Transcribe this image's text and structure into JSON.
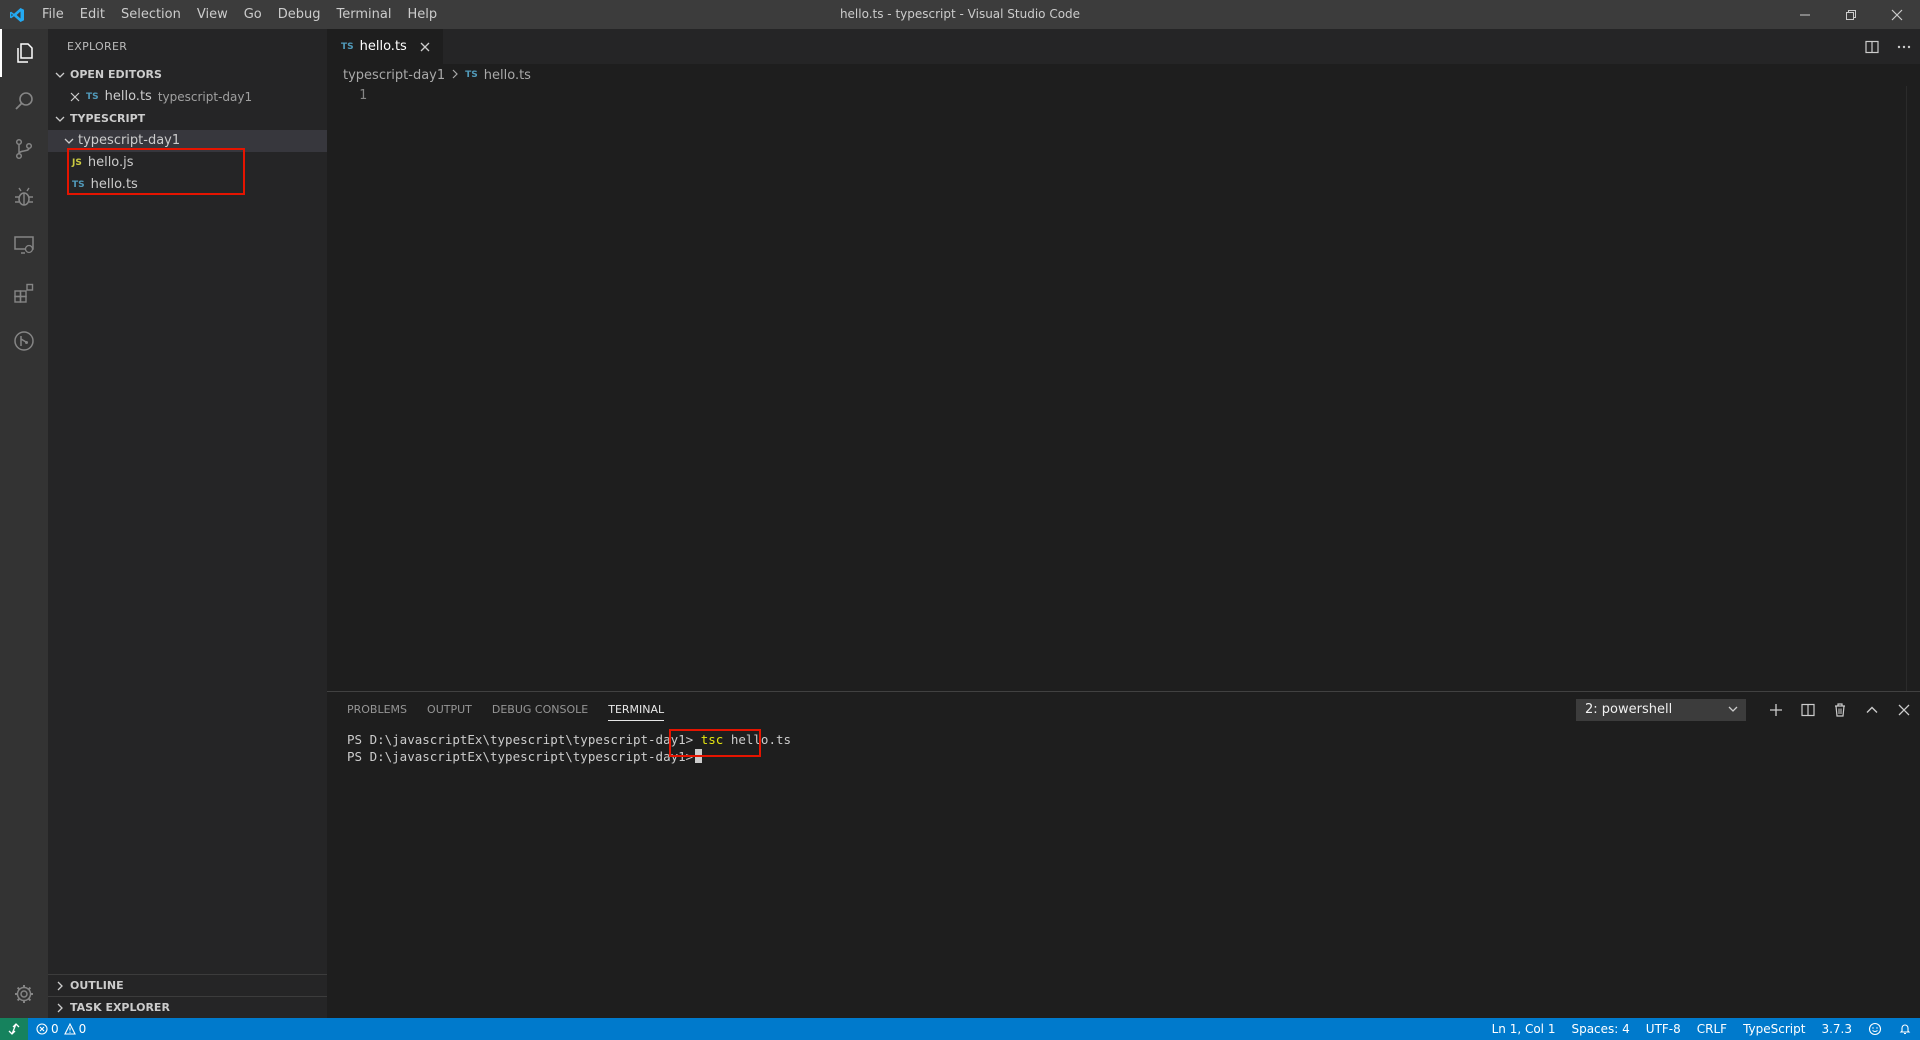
{
  "window": {
    "title": "hello.ts - typescript - Visual Studio Code"
  },
  "menu": [
    "File",
    "Edit",
    "Selection",
    "View",
    "Go",
    "Debug",
    "Terminal",
    "Help"
  ],
  "sidebar": {
    "title": "EXPLORER",
    "open_editors_header": "OPEN EDITORS",
    "open_editor": {
      "badge": "TS",
      "name": "hello.ts",
      "description": "typescript-day1"
    },
    "workspace_header": "TYPESCRIPT",
    "folder": "typescript-day1",
    "files": [
      {
        "badge": "JS",
        "name": "hello.js"
      },
      {
        "badge": "TS",
        "name": "hello.ts"
      }
    ],
    "outline_header": "OUTLINE",
    "task_explorer_header": "TASK EXPLORER"
  },
  "editor": {
    "tab": {
      "badge": "TS",
      "name": "hello.ts"
    },
    "breadcrumb": {
      "folder": "typescript-day1",
      "badge": "TS",
      "file": "hello.ts"
    },
    "line_number": "1"
  },
  "panel": {
    "tabs": [
      "PROBLEMS",
      "OUTPUT",
      "DEBUG CONSOLE",
      "TERMINAL"
    ],
    "active_tab": "TERMINAL",
    "terminal_select": "2: powershell",
    "lines": [
      {
        "prompt": "PS D:\\javascriptEx\\typescript\\typescript-day1>",
        "cmd": "tsc",
        "arg": "hello.ts"
      },
      {
        "prompt": "PS D:\\javascriptEx\\typescript\\typescript-day1>",
        "cmd": "",
        "arg": ""
      }
    ]
  },
  "statusbar": {
    "errors": "0",
    "warnings": "0",
    "position": "Ln 1, Col 1",
    "spaces": "Spaces: 4",
    "encoding": "UTF-8",
    "eol": "CRLF",
    "language": "TypeScript",
    "version": "3.7.3"
  },
  "colors": {
    "accent": "#007acc",
    "highlight": "#e51400",
    "ts_badge": "#519aba",
    "js_badge": "#cbcb41"
  },
  "icons": [
    "vscode-logo-icon",
    "files-icon",
    "search-icon",
    "source-control-icon",
    "debug-icon",
    "remote-explorer-icon",
    "extensions-icon",
    "git-graph-icon",
    "gear-icon",
    "split-editor-icon",
    "more-icon",
    "plus-icon",
    "split-terminal-icon",
    "trash-icon",
    "chevron-up-icon",
    "close-icon",
    "remote-icon",
    "error-icon",
    "warning-icon",
    "feedback-icon",
    "bell-icon"
  ]
}
